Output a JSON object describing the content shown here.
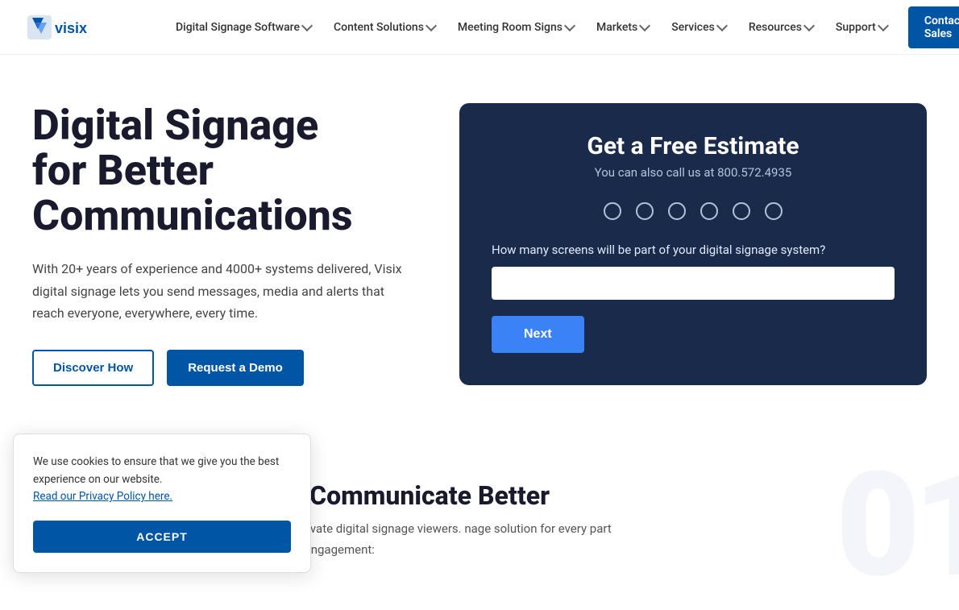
{
  "nav": {
    "logo_alt": "Visix",
    "links": [
      {
        "label": "Digital Signage Software",
        "has_dropdown": true
      },
      {
        "label": "Content Solutions",
        "has_dropdown": true
      },
      {
        "label": "Meeting Room Signs",
        "has_dropdown": true
      },
      {
        "label": "Markets",
        "has_dropdown": true
      },
      {
        "label": "Services",
        "has_dropdown": true
      },
      {
        "label": "Resources",
        "has_dropdown": true
      },
      {
        "label": "Support",
        "has_dropdown": true
      }
    ],
    "cta_label": "Contact Sales",
    "search_aria": "Search"
  },
  "hero": {
    "title_line1": "Digital Signage",
    "title_line2": "for Better",
    "title_line3": "Communications",
    "description": "With 20+ years of experience and 4000+ systems delivered, Visix digital signage lets you send messages, media and alerts that reach everyone, everywhere, every time.",
    "btn_discover": "Discover How",
    "btn_demo": "Request a Demo"
  },
  "estimate": {
    "title": "Get a Free Estimate",
    "subtitle": "You can also call us at 800.572.4935",
    "dots": [
      {
        "active": false
      },
      {
        "active": false
      },
      {
        "active": false
      },
      {
        "active": false
      },
      {
        "active": false
      },
      {
        "active": false
      }
    ],
    "question": "How many screens will be part of your digital signage system?",
    "input_placeholder": "",
    "next_label": "Next"
  },
  "cookie": {
    "text1": "We use cookies to ensure that we give you the best experience on our website.",
    "link_text": "Read our Privacy Policy here.",
    "accept_label": "ACCEPT"
  },
  "lower": {
    "title": "Everything You Need to Communicate Better",
    "description": "visual communications to attract attention and motivate digital signage viewers. nage solution for every part of your business with a three-pronged approach to engagement:",
    "bg_text": "01"
  }
}
